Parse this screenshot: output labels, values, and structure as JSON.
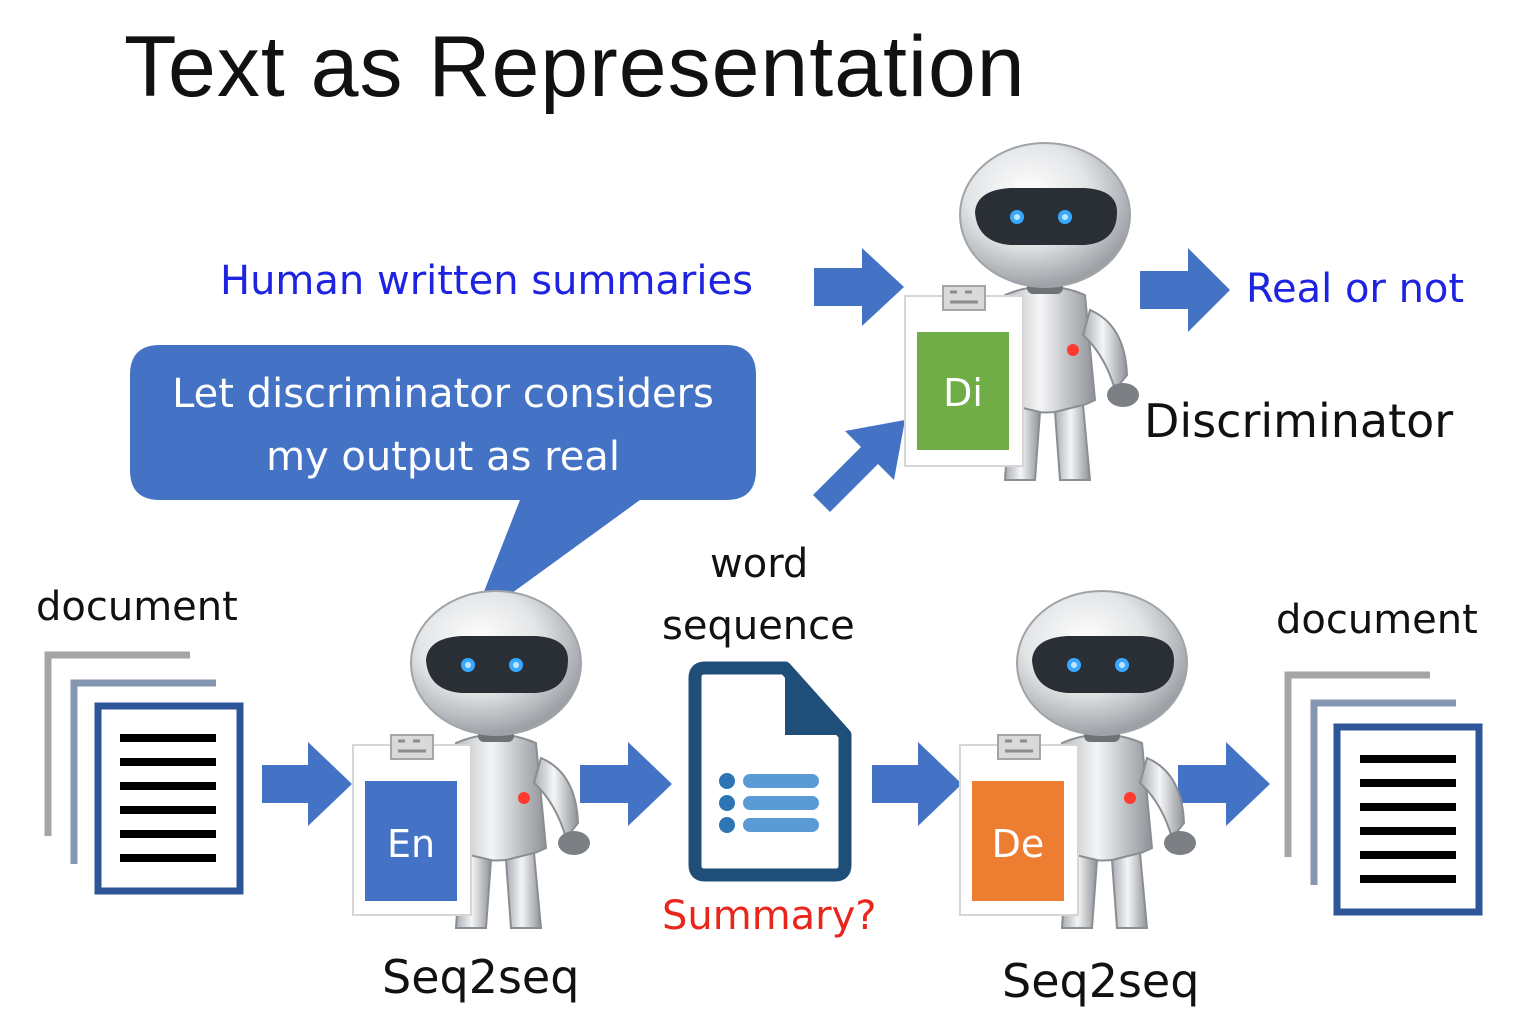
{
  "slide": {
    "title": "Text as Representation"
  },
  "labels": {
    "human_summaries": "Human written summaries",
    "real_or_not": "Real or not",
    "discriminator": "Discriminator",
    "document_left": "document",
    "document_right": "document",
    "word_sequence_line1": "word",
    "word_sequence_line2": "sequence",
    "summary_question": "Summary?",
    "seq2seq_left": "Seq2seq",
    "seq2seq_right": "Seq2seq"
  },
  "bubble": {
    "line1": "Let discriminator considers",
    "line2": "my output as real"
  },
  "robots": {
    "discriminator_box": "Di",
    "encoder_box": "En",
    "decoder_box": "De"
  },
  "colors": {
    "arrow": "#4472c4",
    "bubble": "#4472c4",
    "encoder": "#4472c4",
    "discriminator": "#70ad47",
    "decoder": "#ed7d31",
    "doc_frame": "#2e5597",
    "doc_icon": "#1f4e79",
    "label_blue": "#1d23e0",
    "label_red": "#e8261c"
  },
  "icons": [
    "robot-icon",
    "document-stack-icon",
    "summary-document-icon",
    "arrow-icon"
  ]
}
